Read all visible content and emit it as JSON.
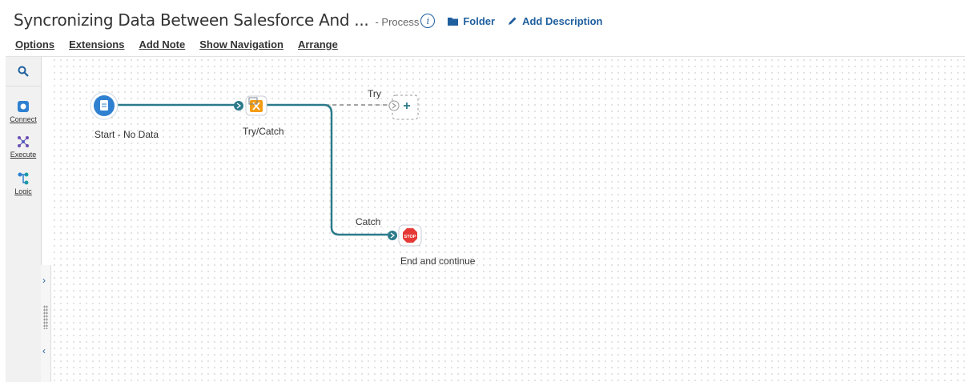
{
  "header": {
    "title": "Syncronizing Data Between Salesforce And ...",
    "subtitle": "- Process",
    "info_icon": "info-icon",
    "folder_label": "Folder",
    "add_description_label": "Add Description"
  },
  "menu": {
    "options": "Options",
    "extensions": "Extensions",
    "add_note": "Add Note",
    "show_navigation": "Show Navigation",
    "arrange": "Arrange"
  },
  "palette": {
    "search_icon": "search-icon",
    "connect": "Connect",
    "execute": "Execute",
    "logic": "Logic"
  },
  "canvas": {
    "start_label": "Start - No Data",
    "trycatch_label": "Try/Catch",
    "try_label": "Try",
    "catch_label": "Catch",
    "end_label": "End and continue",
    "stop_text": "STOP"
  },
  "colors": {
    "accent": "#1f5f9e",
    "connector": "#2b7a8b",
    "start_blue": "#2f80d1",
    "trycatch_orange": "#f39c12",
    "stop_red": "#e53935"
  }
}
